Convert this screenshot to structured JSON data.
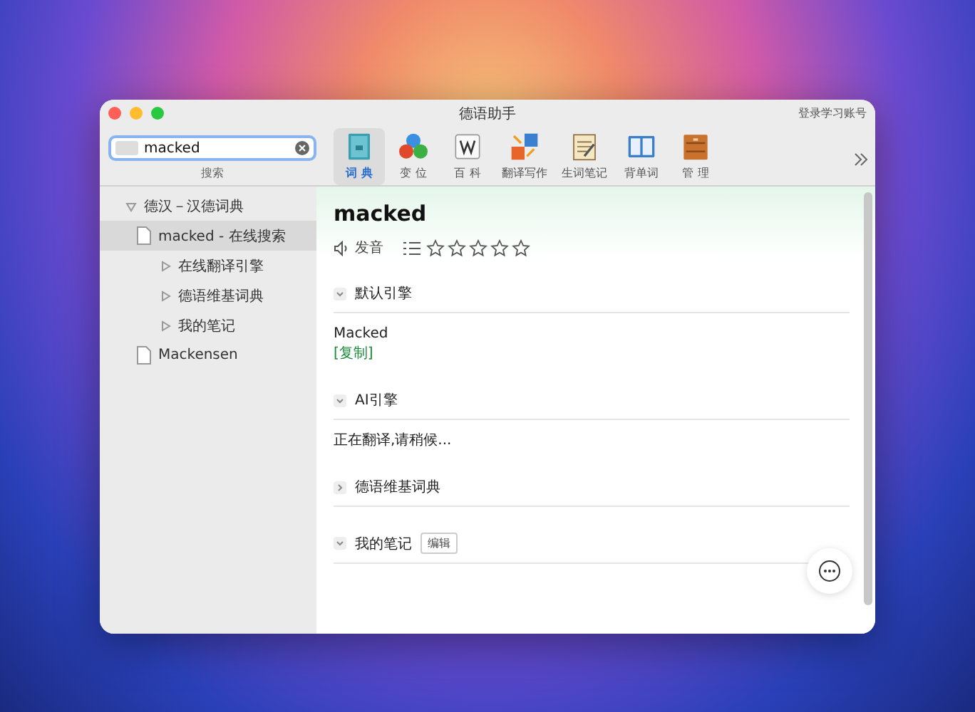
{
  "window": {
    "title": "德语助手",
    "account": "登录学习账号"
  },
  "search": {
    "value": "macked",
    "label": "搜索"
  },
  "tools": [
    {
      "label": "词 典",
      "kind": "dict",
      "selected": true
    },
    {
      "label": "变 位",
      "kind": "conj",
      "selected": false
    },
    {
      "label": "百 科",
      "kind": "wiki",
      "selected": false
    },
    {
      "label": "翻译写作",
      "kind": "translate",
      "selected": false
    },
    {
      "label": "生词笔记",
      "kind": "notes",
      "selected": false
    },
    {
      "label": "背单词",
      "kind": "book",
      "selected": false
    },
    {
      "label": "管 理",
      "kind": "manage",
      "selected": false
    }
  ],
  "tree": [
    {
      "label": "德汉－汉德词典",
      "kind": "folder",
      "expanded": true,
      "selected": false,
      "children": [
        {
          "label": "macked - 在线搜索",
          "kind": "doc",
          "selected": true,
          "children": [
            {
              "label": "在线翻译引擎",
              "kind": "folder",
              "expanded": false,
              "selected": false
            },
            {
              "label": "德语维基词典",
              "kind": "folder",
              "expanded": false,
              "selected": false
            },
            {
              "label": "我的笔记",
              "kind": "folder",
              "expanded": false,
              "selected": false
            }
          ]
        },
        {
          "label": "Mackensen",
          "kind": "doc",
          "selected": false
        }
      ]
    }
  ],
  "entry": {
    "word": "macked",
    "pronounce": "发音",
    "stars": 0
  },
  "sections": [
    {
      "title": "默认引擎",
      "expanded": true,
      "lines": [
        "Macked"
      ],
      "link": "[复制]"
    },
    {
      "title": "AI引擎",
      "expanded": true,
      "lines": [
        "正在翻译,请稍候..."
      ]
    },
    {
      "title": "德语维基词典",
      "expanded": false
    },
    {
      "title": "我的笔记",
      "expanded": true,
      "action": "编辑"
    }
  ]
}
